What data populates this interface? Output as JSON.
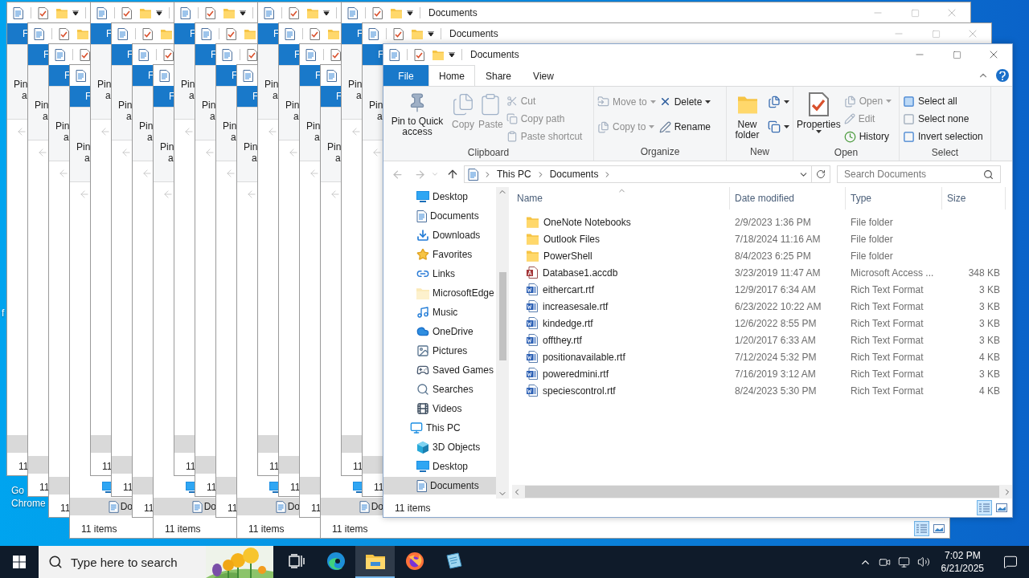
{
  "desktop_icons": [
    {
      "lines": [
        "f"
      ]
    },
    {
      "lines": [
        "Go",
        "Chrome"
      ]
    }
  ],
  "background_windows": [
    {
      "file_tab": "F",
      "pin_label": "Pin",
      "access_label": "a",
      "status": "11"
    },
    {
      "file_tab": "F",
      "pin_label": "Pin",
      "access_label": "a",
      "status": "11"
    },
    {
      "file_tab": "F",
      "pin_label": "Pin",
      "access_label": "a",
      "status": "11"
    },
    {
      "file_tab": "F",
      "pin_label": "Pin",
      "access_label": "a",
      "status": "11 items",
      "sidebar_label": "Do"
    },
    {
      "file_tab": "F",
      "pin_label": "Pin",
      "access_label": "a",
      "status": "11"
    },
    {
      "file_tab": "F",
      "pin_label": "Pin",
      "access_label": "a",
      "status": "11"
    },
    {
      "file_tab": "F",
      "pin_label": "Pin",
      "access_label": "a",
      "status": "11"
    },
    {
      "file_tab": "F",
      "pin_label": "Pin",
      "access_label": "a",
      "status": "11 items",
      "sidebar_label": "Do"
    },
    {
      "file_tab": "F",
      "pin_label": "Pin",
      "access_label": "a",
      "status": "11"
    },
    {
      "file_tab": "F",
      "pin_label": "Pin",
      "access_label": "a",
      "status": "11"
    },
    {
      "file_tab": "F",
      "pin_label": "Pin",
      "access_label": "a",
      "status": "11"
    },
    {
      "file_tab": "F",
      "pin_label": "Pin",
      "access_label": "a",
      "status": "11 items",
      "sidebar_label": "Do"
    },
    {
      "file_tab": "F",
      "pin_label": "Pin",
      "access_label": "a",
      "status": "11"
    },
    {
      "file_tab": "F",
      "pin_label": "Pin",
      "access_label": "a",
      "status": "11"
    },
    {
      "file_tab": "F",
      "pin_label": "Pin",
      "access_label": "a",
      "status": "11"
    },
    {
      "file_tab": "F",
      "pin_label": "Pin",
      "access_label": "a",
      "status": "11 items",
      "sidebar_label": "Do",
      "view_buttons": [
        {
          "selected": true
        },
        {
          "selected": false
        }
      ]
    },
    {
      "title": "Documents",
      "file_tab": "F",
      "pin_label": "Pin",
      "access_label": "a",
      "status": "11"
    },
    {
      "title": "Documents",
      "file_tab": "F",
      "pin_label": "Pin",
      "access_label": "a",
      "status": "11"
    }
  ],
  "window": {
    "title": "Documents",
    "tabs": [
      {
        "label": "File",
        "kind": "file",
        "selected": false
      },
      {
        "label": "Home",
        "kind": "tab",
        "selected": true
      },
      {
        "label": "Share",
        "kind": "tab",
        "selected": false
      },
      {
        "label": "View",
        "kind": "tab",
        "selected": false
      }
    ],
    "ribbon": [
      {
        "label": "Clipboard",
        "buttons": [
          {
            "label": "Pin to Quick access",
            "kind": "pin",
            "disabled": false
          },
          {
            "label": "Copy",
            "kind": "copy",
            "disabled": true
          },
          {
            "label": "Paste",
            "kind": "paste",
            "disabled": true
          }
        ],
        "columns": [
          [
            {
              "label": "Cut",
              "kind": "cut",
              "disabled": true
            },
            {
              "label": "Copy path",
              "kind": "copypath",
              "disabled": true
            },
            {
              "label": "Paste shortcut",
              "kind": "shortcut",
              "disabled": true
            }
          ]
        ]
      },
      {
        "label": "Organize",
        "columns": [
          [
            {
              "label": "Move to",
              "kind": "move",
              "disabled": true
            },
            {
              "label": "Copy to",
              "kind": "copyto",
              "disabled": true
            }
          ],
          [
            {
              "label": "Delete",
              "kind": "delete",
              "disabled": false
            },
            {
              "label": "Rename",
              "kind": "rename",
              "disabled": false
            }
          ]
        ]
      },
      {
        "label": "New",
        "buttons": [
          {
            "label": "New folder",
            "kind": "newfolder",
            "disabled": false
          }
        ],
        "columns": [
          [
            {
              "kind": "newitem",
              "disabled": false
            },
            {
              "kind": "easyaccess",
              "disabled": false
            }
          ]
        ]
      },
      {
        "label": "Open",
        "buttons": [
          {
            "label": "Properties",
            "kind": "properties",
            "disabled": false
          }
        ],
        "columns": [
          [
            {
              "label": "Open",
              "kind": "open",
              "disabled": true
            },
            {
              "label": "Edit",
              "kind": "edit",
              "disabled": true
            },
            {
              "label": "History",
              "kind": "history",
              "disabled": false
            }
          ]
        ]
      },
      {
        "label": "Select",
        "columns": [
          [
            {
              "label": "Select all",
              "kind": "selectall",
              "disabled": false
            },
            {
              "label": "Select none",
              "kind": "selectnone",
              "disabled": false
            },
            {
              "label": "Invert selection",
              "kind": "invert",
              "disabled": false
            }
          ]
        ]
      }
    ],
    "address": {
      "breadcrumbs": [
        "This PC",
        "Documents"
      ]
    },
    "search": {
      "placeholder": "Search Documents"
    },
    "sidebar": {
      "tree": [
        {
          "children": [
            {
              "label": "Desktop",
              "kind": "desktop",
              "selected": false
            },
            {
              "label": "Documents",
              "kind": "documents",
              "selected": false
            },
            {
              "label": "Downloads",
              "kind": "downloads",
              "selected": false
            },
            {
              "label": "Favorites",
              "kind": "favorites",
              "selected": false
            },
            {
              "label": "Links",
              "kind": "links",
              "selected": false
            },
            {
              "label": "MicrosoftEdge",
              "kind": "folder",
              "selected": false
            },
            {
              "label": "Music",
              "kind": "music",
              "selected": false
            },
            {
              "label": "OneDrive",
              "kind": "onedrive",
              "selected": false
            },
            {
              "label": "Pictures",
              "kind": "pictures",
              "selected": false
            },
            {
              "label": "Saved Games",
              "kind": "games",
              "selected": false
            },
            {
              "label": "Searches",
              "kind": "searches",
              "selected": false
            },
            {
              "label": "Videos",
              "kind": "videos",
              "selected": false
            }
          ]
        },
        {
          "label": "This PC",
          "kind": "pc",
          "selected": false,
          "children": [
            {
              "label": "3D Objects",
              "kind": "objects",
              "selected": false
            },
            {
              "label": "Desktop",
              "kind": "desktop",
              "selected": false
            },
            {
              "label": "Documents",
              "kind": "documents",
              "selected": true
            }
          ]
        }
      ]
    },
    "columns": [
      {
        "label": "Name",
        "sorted": true
      },
      {
        "label": "Date modified",
        "sorted": false
      },
      {
        "label": "Type",
        "sorted": false
      },
      {
        "label": "Size",
        "sorted": false
      }
    ],
    "files": [
      {
        "name": "OneNote Notebooks",
        "date": "2/9/2023 1:36 PM",
        "type": "File folder",
        "kind": "folder",
        "selected": false
      },
      {
        "name": "Outlook Files",
        "date": "7/18/2024 11:16 AM",
        "type": "File folder",
        "kind": "folder",
        "selected": false
      },
      {
        "name": "PowerShell",
        "date": "8/4/2023 6:25 PM",
        "type": "File folder",
        "kind": "folder",
        "selected": false
      },
      {
        "name": "Database1.accdb",
        "date": "3/23/2019 11:47 AM",
        "type": "Microsoft Access ...",
        "size": "348 KB",
        "kind": "access",
        "selected": false
      },
      {
        "name": "eithercart.rtf",
        "date": "12/9/2017 6:34 AM",
        "type": "Rich Text Format",
        "size": "3 KB",
        "kind": "rtf",
        "selected": false
      },
      {
        "name": "increasesale.rtf",
        "date": "6/23/2022 10:22 AM",
        "type": "Rich Text Format",
        "size": "3 KB",
        "kind": "rtf",
        "selected": false
      },
      {
        "name": "kindedge.rtf",
        "date": "12/6/2022 8:55 PM",
        "type": "Rich Text Format",
        "size": "3 KB",
        "kind": "rtf",
        "selected": false
      },
      {
        "name": "offthey.rtf",
        "date": "1/20/2017 6:33 AM",
        "type": "Rich Text Format",
        "size": "3 KB",
        "kind": "rtf",
        "selected": false
      },
      {
        "name": "positionavailable.rtf",
        "date": "7/12/2024 5:32 PM",
        "type": "Rich Text Format",
        "size": "4 KB",
        "kind": "rtf",
        "selected": false
      },
      {
        "name": "poweredmini.rtf",
        "date": "7/16/2019 3:12 AM",
        "type": "Rich Text Format",
        "size": "3 KB",
        "kind": "rtf",
        "selected": false
      },
      {
        "name": "speciescontrol.rtf",
        "date": "8/24/2023 5:30 PM",
        "type": "Rich Text Format",
        "size": "4 KB",
        "kind": "rtf",
        "selected": false
      }
    ],
    "status": "11 items",
    "view_buttons": [
      {
        "selected": true
      },
      {
        "selected": false
      }
    ]
  },
  "taskbar": {
    "search": {
      "placeholder": "Type here to search"
    },
    "apps": [
      {
        "kind": "taskview",
        "selected": false
      },
      {
        "kind": "edge",
        "selected": false
      },
      {
        "kind": "explorer",
        "selected": true
      },
      {
        "kind": "firefox",
        "selected": false
      },
      {
        "kind": "notepad",
        "selected": false
      }
    ],
    "time": "7:02 PM",
    "date": "6/21/2025"
  }
}
